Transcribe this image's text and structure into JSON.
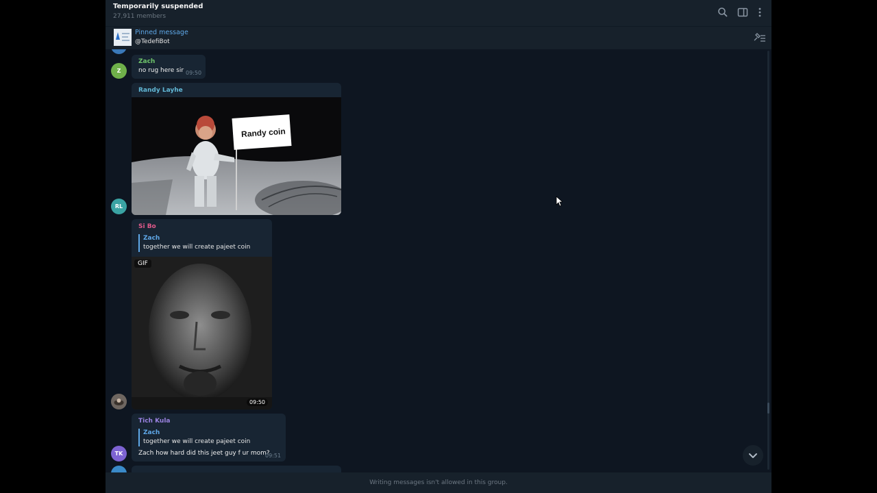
{
  "header": {
    "title": "Temporarily suspended",
    "members": "27,911 members",
    "icons": [
      "search-icon",
      "sidebar-toggle-icon",
      "more-vertical-icon"
    ]
  },
  "pinned": {
    "title": "Pinned message",
    "text": "@TedefiBot",
    "icon": "pinned-list-icon"
  },
  "messages": [
    {
      "sender": "Zach",
      "sender_color": "#6fc56b",
      "avatar": "Z",
      "avatar_color": "#6fb04a",
      "text": "no rug here sir",
      "time": "09:50"
    },
    {
      "sender": "Randy Layhe",
      "sender_color": "#62b8d6",
      "avatar": "RL",
      "avatar_color": "#3aa3a3",
      "image_caption": "Randy coin"
    },
    {
      "sender": "Si Bo",
      "sender_color": "#e05a8a",
      "reply_name": "Zach",
      "reply_text": "together we will create pajeet coin",
      "gif_label": "GIF",
      "time": "09:50"
    },
    {
      "sender": "Tich Kula",
      "sender_color": "#9a82e0",
      "avatar": "TK",
      "avatar_color": "#7d63d2",
      "reply_name": "Zach",
      "reply_text": "together we will create pajeet coin",
      "text": "Zach how hard did this jeet guy f ur mom?",
      "time": "09:51"
    }
  ],
  "footer": {
    "text": "Writing messages isn't allowed in this group."
  }
}
